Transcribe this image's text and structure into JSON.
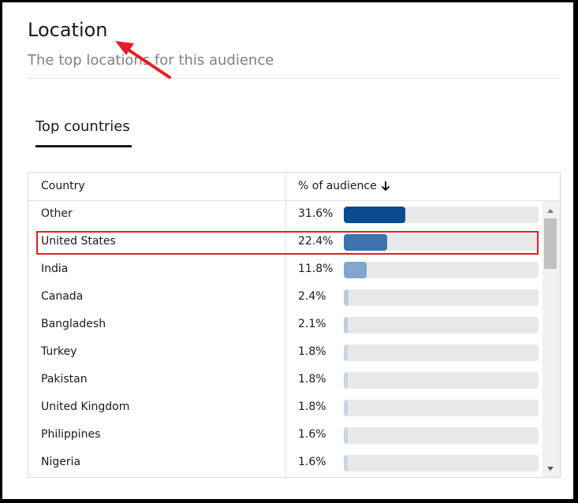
{
  "header": {
    "title": "Location",
    "subtitle": "The top locations for this audience"
  },
  "tabs": [
    {
      "label": "Top countries",
      "active": true
    }
  ],
  "table": {
    "columns": {
      "country": "Country",
      "audience": "% of audience"
    },
    "sort_icon": "arrow-down-icon",
    "rows": [
      {
        "country": "Other",
        "percent": "31.6%",
        "value": 31.6,
        "color": "#0a4a91"
      },
      {
        "country": "United States",
        "percent": "22.4%",
        "value": 22.4,
        "color": "#3a73ad",
        "highlighted": true
      },
      {
        "country": "India",
        "percent": "11.8%",
        "value": 11.8,
        "color": "#7fa6cc"
      },
      {
        "country": "Canada",
        "percent": "2.4%",
        "value": 2.4,
        "color": "#b8cde2"
      },
      {
        "country": "Bangladesh",
        "percent": "2.1%",
        "value": 2.1,
        "color": "#b8cde2"
      },
      {
        "country": "Turkey",
        "percent": "1.8%",
        "value": 1.8,
        "color": "#c4d5e7"
      },
      {
        "country": "Pakistan",
        "percent": "1.8%",
        "value": 1.8,
        "color": "#c4d5e7"
      },
      {
        "country": "United Kingdom",
        "percent": "1.8%",
        "value": 1.8,
        "color": "#c4d5e7"
      },
      {
        "country": "Philippines",
        "percent": "1.6%",
        "value": 1.6,
        "color": "#c4d5e7"
      },
      {
        "country": "Nigeria",
        "percent": "1.6%",
        "value": 1.6,
        "color": "#c4d5e7"
      }
    ]
  },
  "annotation": {
    "arrow_color": "#e41e26",
    "highlight_color": "#e41e26"
  }
}
